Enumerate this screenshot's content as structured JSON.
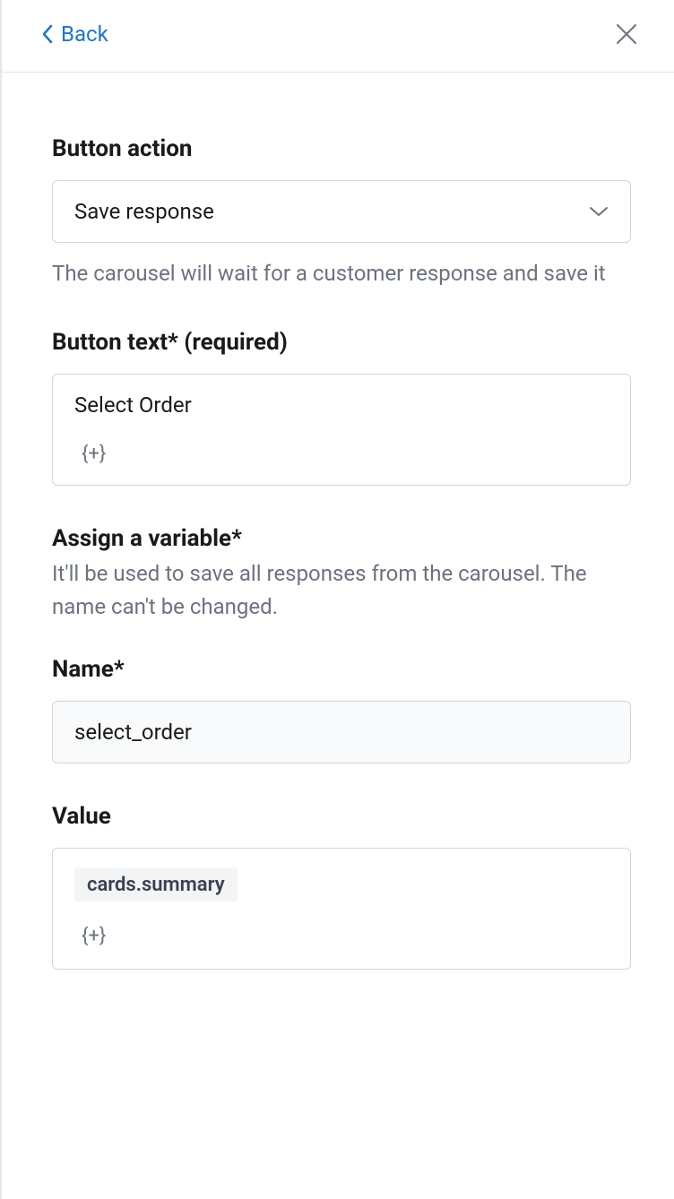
{
  "header": {
    "back_label": "Back"
  },
  "form": {
    "button_action": {
      "label": "Button action",
      "value": "Save response",
      "help": "The carousel will wait for a customer response and save it"
    },
    "button_text": {
      "label": "Button text* (required)",
      "value": "Select Order",
      "insert_symbol": "{+}"
    },
    "assign_variable": {
      "label": "Assign a variable*",
      "sub": "It'll be used to save all responses from the carousel. The name can't be changed."
    },
    "name": {
      "label": "Name*",
      "value": "select_order"
    },
    "value": {
      "label": "Value",
      "chip": "cards.summary",
      "insert_symbol": "{+}"
    }
  }
}
